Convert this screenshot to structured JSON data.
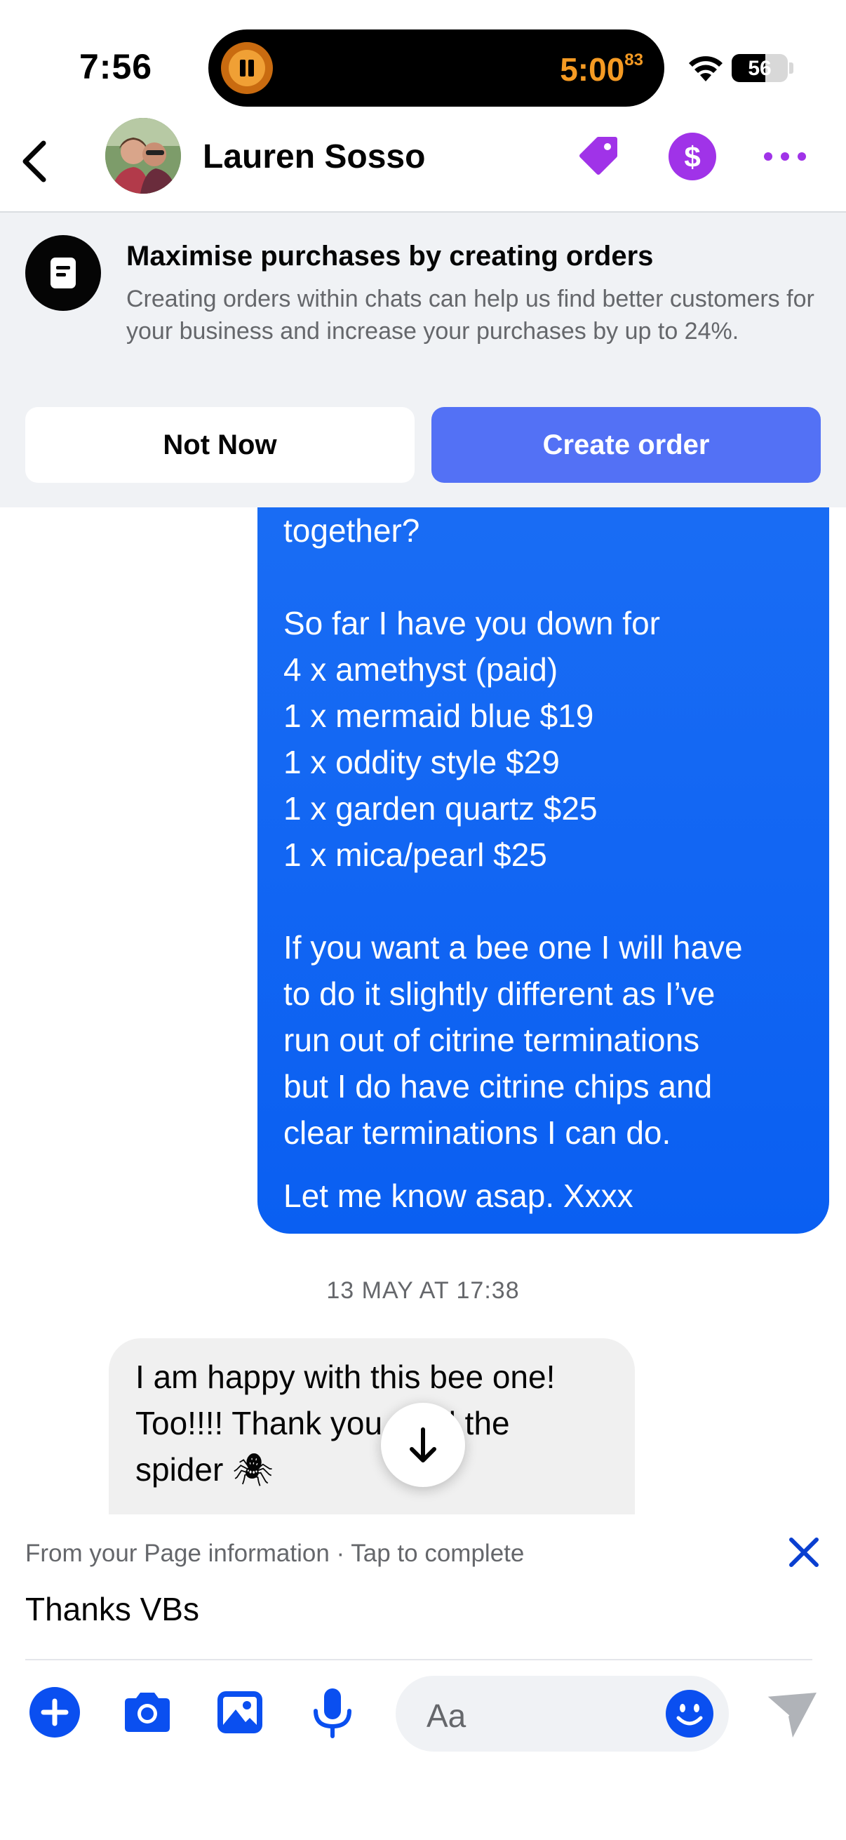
{
  "status_bar": {
    "time": "7:56",
    "timer_main": "5:00",
    "timer_frac": "83",
    "battery": "56"
  },
  "header": {
    "contact_name": "Lauren Sosso",
    "accent_color": "#a033e8"
  },
  "banner": {
    "title": "Maximise purchases by creating orders",
    "description": "Creating orders within chats can help us find better customers for your business and increase your purchases by up to 24%.",
    "not_now_label": "Not Now",
    "create_label": "Create order"
  },
  "conversation": {
    "outgoing_lines": [
      "together?",
      "",
      "So far I have you down for",
      "4 x amethyst (paid)",
      "1 x mermaid blue $19",
      "1 x oddity style $29",
      "1 x garden quartz $25",
      "1 x mica/pearl $25",
      "",
      "If you want a bee one I will have",
      "to do it slightly different as I’ve",
      "run out of citrine terminations",
      "but I do have citrine chips and",
      "clear terminations I can do.",
      "",
      "Let me know asap. Xxxx"
    ],
    "timestamp": "13 MAY AT 17:38",
    "incoming_lines": [
      "I am happy with this bee one!",
      "Too!!!! Thank you. And the",
      "spider 🕷"
    ]
  },
  "suggestion": {
    "hint": "From your Page information · Tap to complete",
    "reply": "Thanks VBs"
  },
  "composer": {
    "placeholder": "Aa",
    "icon_color": "#0a4ff0"
  }
}
